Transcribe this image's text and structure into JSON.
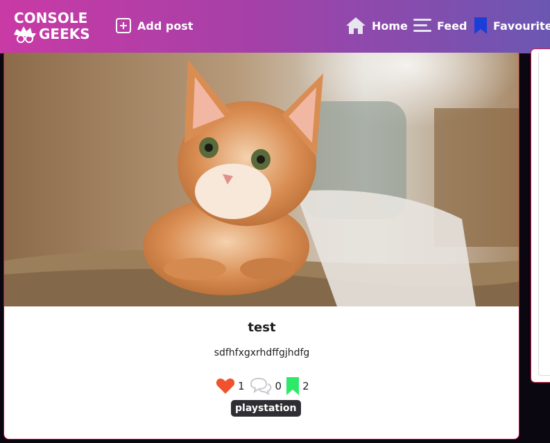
{
  "brand": {
    "line1": "CONSOLE",
    "line2": "GEEKS"
  },
  "nav": {
    "add_post": "Add post",
    "home": "Home",
    "feed": "Feed",
    "favourites": "Favourites"
  },
  "post": {
    "image_alt": "kitten photo",
    "title": "test",
    "body": "sdfhfxgxrhdffgjhdfg",
    "likes": "1",
    "comments": "0",
    "bookmarks": "2",
    "tag": "playstation"
  },
  "colors": {
    "nav_gradient_start": "#c93aa5",
    "nav_gradient_end": "#6b57b2",
    "like": "#f0512e",
    "bookmark": "#2ee86a",
    "card_border": "#c8103a",
    "tag_bg": "#2f2f33"
  },
  "icons": {
    "add": "plus-square-icon",
    "home": "house-icon",
    "feed": "hamburger-icon",
    "favourites": "bookmark-icon",
    "like": "heart-icon",
    "comments": "comments-icon",
    "bookmark": "bookmark-icon"
  }
}
